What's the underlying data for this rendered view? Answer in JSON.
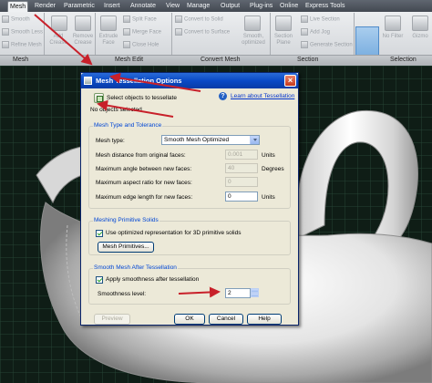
{
  "ribbon": {
    "tabs": [
      "Mesh",
      "Render",
      "Parametric",
      "Insert",
      "Annotate",
      "View",
      "Manage",
      "Output",
      "Plug-ins",
      "Online",
      "Express Tools"
    ],
    "active_tab": "Mesh",
    "buttons": {
      "smooth": "Smooth",
      "smooth_less": "Smooth Less",
      "refine_mesh": "Refine Mesh",
      "add_crease": "Add Crease",
      "remove_crease": "Remove Crease",
      "extrude_face": "Extrude Face",
      "split_face": "Split Face",
      "merge_face": "Merge Face",
      "close_hole": "Close Hole",
      "convert_to_solid": "Convert to Solid",
      "convert_to_surface": "Convert to Surface",
      "smooth_optimized": "Smooth, optimized",
      "section_plane": "Section Plane",
      "live_section": "Live Section",
      "add_jog": "Add Jog",
      "generate_section": "Generate Section",
      "no_filter": "No Filter",
      "gizmo": "Gizmo"
    },
    "panels": [
      "Mesh",
      "Mesh Edit",
      "Convert Mesh",
      "Section",
      "Selection"
    ]
  },
  "dialog": {
    "title": "Mesh Tessellation Options",
    "select_objects": "Select objects to tessellate",
    "no_objects": "No objects selected",
    "learn_link": "Learn about Tessellation",
    "group_type": {
      "title": "Mesh Type and Tolerance",
      "mesh_type_label": "Mesh type:",
      "mesh_type_value": "Smooth Mesh Optimized",
      "distance_label": "Mesh distance from original faces:",
      "distance_value": "0.001",
      "distance_unit": "Units",
      "angle_label": "Maximum angle between new faces:",
      "angle_value": "40",
      "angle_unit": "Degrees",
      "aspect_label": "Maximum aspect ratio for new faces:",
      "aspect_value": "0",
      "edge_label": "Maximum edge length for new faces:",
      "edge_value": "0",
      "edge_unit": "Units"
    },
    "group_primitive": {
      "title": "Meshing Primitive Solids",
      "checkbox_label": "Use optimized representation for 3D primitive solids",
      "button": "Mesh Primitives..."
    },
    "group_smooth": {
      "title": "Smooth Mesh After Tessellation",
      "checkbox_label": "Apply smoothness after tessellation",
      "level_label": "Smoothness level:",
      "level_value": "2"
    },
    "buttons": {
      "preview": "Preview",
      "ok": "OK",
      "cancel": "Cancel",
      "help": "Help"
    }
  },
  "colors": {
    "annotation_arrow": "#c8202a",
    "title_bar": "#0a4ac6",
    "dialog_bg": "#ece9d8",
    "group_title": "#0046d5"
  }
}
